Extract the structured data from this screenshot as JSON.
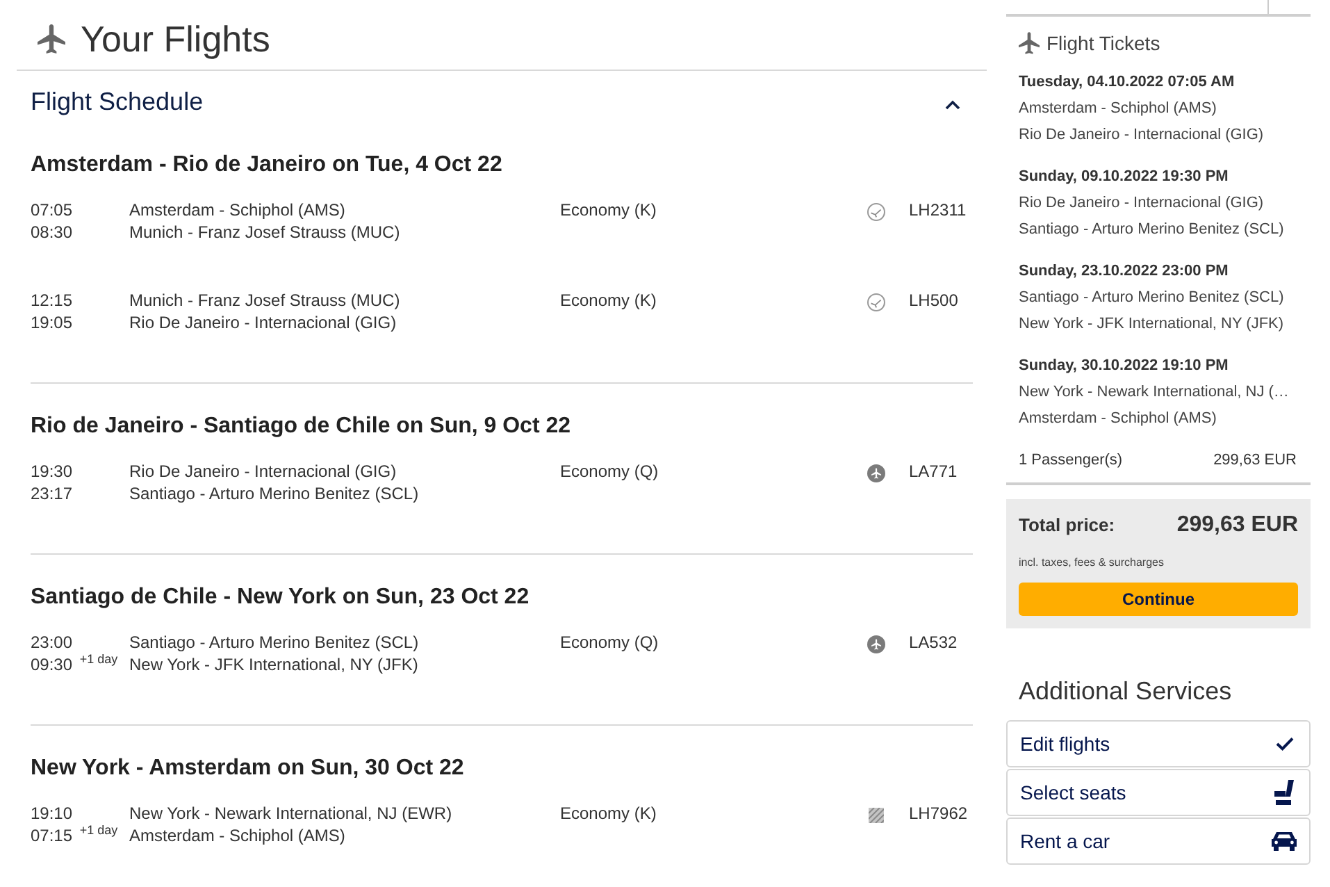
{
  "page": {
    "title": "Your Flights"
  },
  "schedule": {
    "title": "Flight Schedule",
    "expanded": true,
    "legs": [
      {
        "title": "Amsterdam - Rio de Janeiro on Tue, 4 Oct 22",
        "segments": [
          {
            "departure_time": "07:05",
            "arrival_time": "08:30",
            "from": "Amsterdam - Schiphol (AMS)",
            "to": "Munich - Franz Josef Strauss (MUC)",
            "cabin": "Economy (K)",
            "kind": "ring",
            "flight": "LH2311"
          },
          {
            "departure_time": "12:15",
            "arrival_time": "19:05",
            "from": "Munich - Franz Josef Strauss (MUC)",
            "to": "Rio De Janeiro - Internacional (GIG)",
            "cabin": "Economy (K)",
            "kind": "ring",
            "flight": "LH500"
          }
        ]
      },
      {
        "title": "Rio de Janeiro - Santiago de Chile on Sun, 9 Oct 22",
        "segments": [
          {
            "departure_time": "19:30",
            "arrival_time": "23:17",
            "from": "Rio De Janeiro - Internacional (GIG)",
            "to": "Santiago - Arturo Merino Benitez (SCL)",
            "cabin": "Economy (Q)",
            "kind": "disc",
            "flight": "LA771"
          }
        ]
      },
      {
        "title": "Santiago de Chile - New York on Sun, 23 Oct 22",
        "segments": [
          {
            "departure_time": "23:00",
            "arrival_time": "09:30 $^{+1 day}$",
            "from": "Santiago - Arturo Merino Benitez (SCL)",
            "to": "New York - JFK International, NY (JFK)",
            "cabin": "Economy (Q)",
            "kind": "disc",
            "flight": "LA532"
          }
        ]
      },
      {
        "title": "New York - Amsterdam on Sun, 30 Oct 22",
        "segments": [
          {
            "departure_time": "19:10",
            "arrival_time": "07:15 $^{+1 day}$",
            "from": "New York - Newark International, NJ (EWR)",
            "to": "Amsterdam - Schiphol (AMS)",
            "cabin": "Economy (K)",
            "kind": "tile",
            "flight": "LH7962"
          }
        ]
      }
    ]
  },
  "tickets": {
    "title": "Flight Tickets",
    "items": [
      {
        "date": "Tuesday, 04.10.2022 07:05 AM",
        "from": "Amsterdam - Schiphol (AMS)",
        "to": "Rio De Janeiro - Internacional (GIG)"
      },
      {
        "date": "Sunday, 09.10.2022 19:30 PM",
        "from": "Rio De Janeiro - Internacional (GIG)",
        "to": "Santiago - Arturo Merino Benitez (SCL)"
      },
      {
        "date": "Sunday, 23.10.2022 23:00 PM",
        "from": "Santiago - Arturo Merino Benitez (SCL)",
        "to": "New York - JFK International, NY (JFK)"
      },
      {
        "date": "Sunday, 30.10.2022 19:10 PM",
        "from": "New York - Newark International, NJ (…",
        "to": "Amsterdam - Schiphol (AMS)"
      }
    ],
    "passengers": "1 Passenger(s)",
    "passengers_price": "299,63 EUR"
  },
  "total": {
    "label": "Total price:",
    "price": "299,63 EUR",
    "note": "incl. taxes, fees & surcharges",
    "button": "Continue"
  },
  "services": {
    "title": "Additional Services",
    "items": [
      {
        "label": "Edit flights",
        "kind": "check"
      },
      {
        "label": "Select seats",
        "kind": "seat"
      },
      {
        "label": "Rent a car",
        "kind": "car"
      }
    ]
  }
}
